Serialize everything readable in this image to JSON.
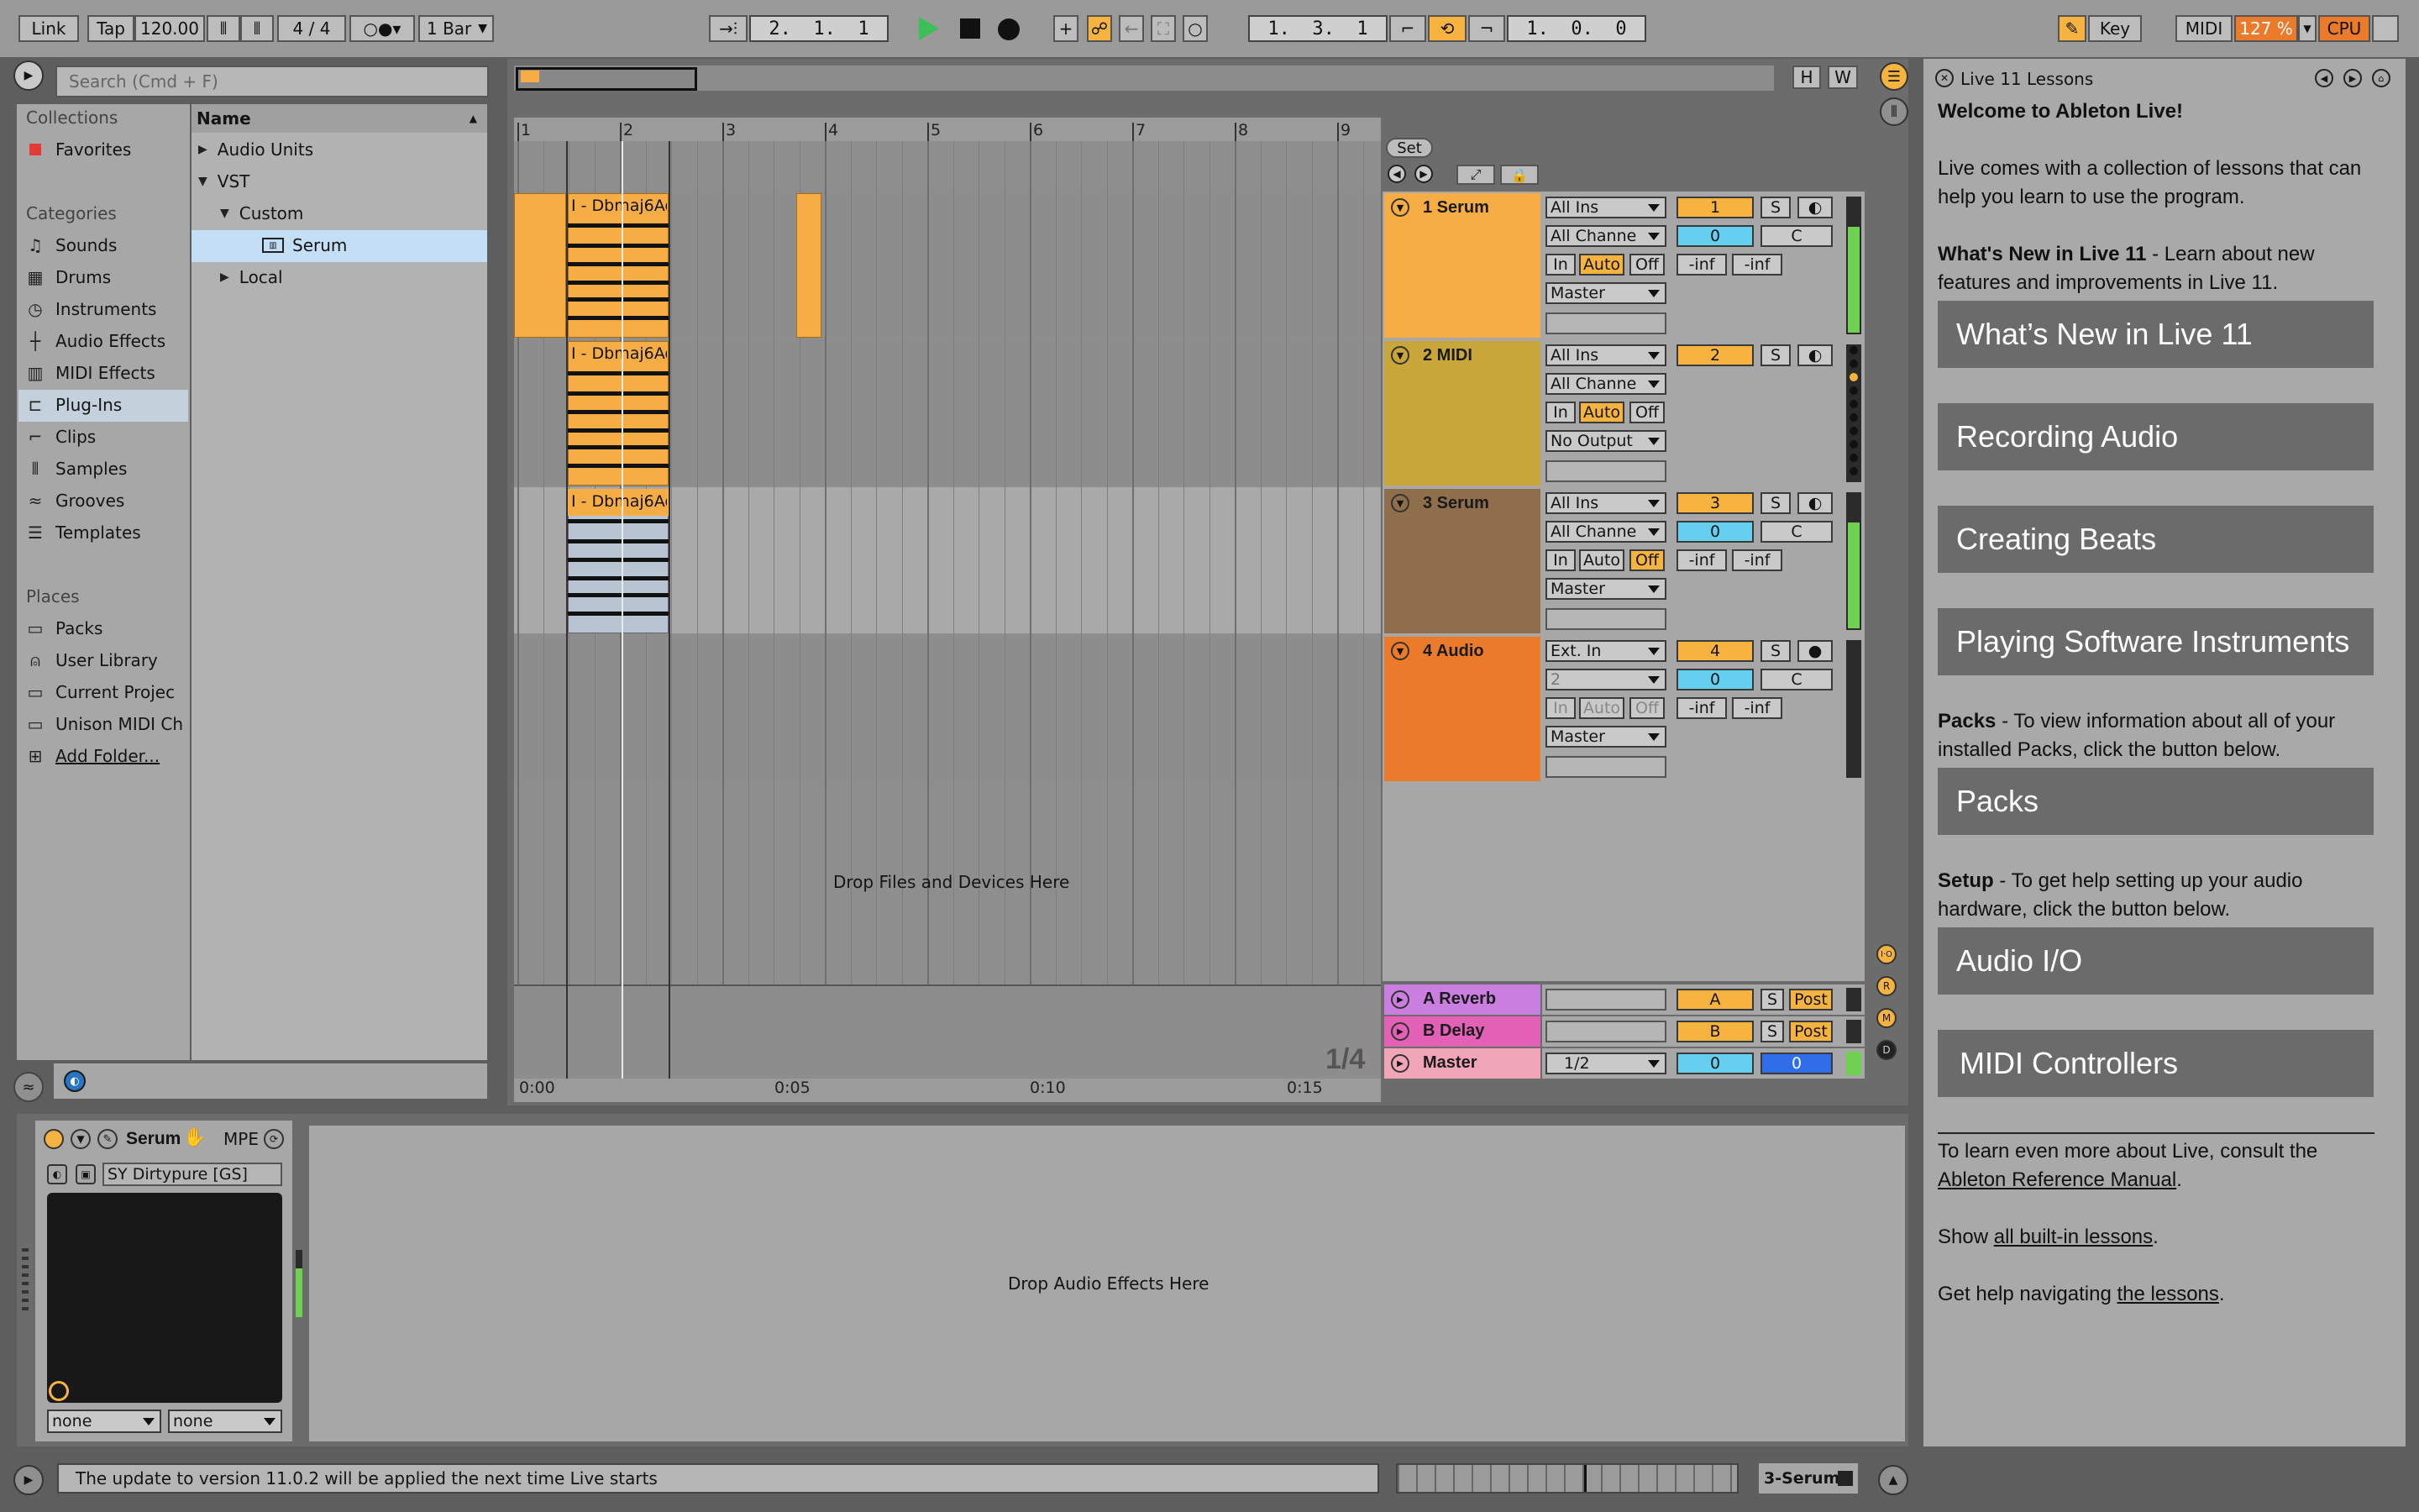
{
  "transport": {
    "link": "Link",
    "tap": "Tap",
    "tempo": "120.00",
    "time_signature": "4 / 4",
    "quantize": "1 Bar",
    "position": "2.  1.  1",
    "loop_start": "1.  3.  1",
    "loop_length": "1.  0.  0",
    "key_label": "Key",
    "midi_label": "MIDI",
    "zoom": "127 %",
    "cpu_label": "CPU"
  },
  "browser": {
    "search_placeholder": "Search (Cmd + F)",
    "collections_title": "Collections",
    "favorites": "Favorites",
    "categories_title": "Categories",
    "categories": [
      "Sounds",
      "Drums",
      "Instruments",
      "Audio Effects",
      "MIDI Effects",
      "Plug-Ins",
      "Clips",
      "Samples",
      "Grooves",
      "Templates"
    ],
    "places_title": "Places",
    "places": [
      "Packs",
      "User Library",
      "Current Projec",
      "Unison MIDI Ch",
      "Add Folder..."
    ],
    "name_header": "Name",
    "tree": {
      "audio_units": "Audio Units",
      "vst": "VST",
      "custom": "Custom",
      "serum": "Serum",
      "local": "Local"
    }
  },
  "arrangement": {
    "bar_numbers": [
      "1",
      "2",
      "3",
      "4",
      "5",
      "6",
      "7",
      "8",
      "9"
    ],
    "clip_name": "I - Dbmaj6Ad",
    "drop_files": "Drop Files and Devices Here",
    "page_indicator": "1/4",
    "time_labels": [
      "0:00",
      "0:05",
      "0:10",
      "0:15"
    ],
    "set_label": "Set",
    "h_label": "H",
    "w_label": "W"
  },
  "tracks": [
    {
      "name": "1 Serum",
      "input": "All Ins",
      "channel": "All Channe",
      "monitor": [
        "In",
        "Auto",
        "Off"
      ],
      "output": "Master",
      "number": "1",
      "volume": "0",
      "pan": "C",
      "peak_l": "-inf",
      "peak_r": "-inf",
      "color": "#f6ad44"
    },
    {
      "name": "2 MIDI",
      "input": "All Ins",
      "channel": "All Channe",
      "monitor": [
        "In",
        "Auto",
        "Off"
      ],
      "output": "No Output",
      "number": "2",
      "color": "#c8a63a"
    },
    {
      "name": "3 Serum",
      "input": "All Ins",
      "channel": "All Channe",
      "monitor": [
        "In",
        "Auto",
        "Off"
      ],
      "output": "Master",
      "number": "3",
      "volume": "0",
      "pan": "C",
      "peak_l": "-inf",
      "peak_r": "-inf",
      "color": "#8e6e4b"
    },
    {
      "name": "4 Audio",
      "input": "Ext. In",
      "channel": "2",
      "monitor": [
        "In",
        "Auto",
        "Off"
      ],
      "output": "Master",
      "number": "4",
      "volume": "0",
      "pan": "C",
      "peak_l": "-inf",
      "peak_r": "-inf",
      "color": "#ec7a2b"
    }
  ],
  "returns": [
    {
      "name": "A Reverb",
      "letter": "A",
      "post": "Post",
      "color": "#c97ee0"
    },
    {
      "name": "B Delay",
      "letter": "B",
      "post": "Post",
      "color": "#e261b7"
    },
    {
      "name": "Master",
      "output": "1/2",
      "volume": "0",
      "pan": "0",
      "color": "#f0a6b8"
    }
  ],
  "mixer_labels": {
    "solo": "S"
  },
  "device": {
    "name": "Serum",
    "mpe": "MPE",
    "preset": "SY Dirtypure [GS]",
    "macro1": "none",
    "macro2": "none",
    "drop_effects": "Drop Audio Effects Here"
  },
  "status": {
    "message": "The update to version 11.0.2 will be applied the next time Live starts",
    "selected_track": "3-Serum"
  },
  "lessons": {
    "title": "Live 11 Lessons",
    "welcome": "Welcome to Ableton Live!",
    "intro": "Live comes with a collection of lessons that can help you learn to use the program.",
    "whats_new_bold": "What's New in Live 11",
    "whats_new_text": " - Learn about new features and improvements in Live 11.",
    "buttons": [
      "What’s New in Live 11",
      "Recording Audio",
      "Creating Beats",
      "Playing Software Instruments"
    ],
    "packs_bold": "Packs",
    "packs_text": " - To view information about all of your installed Packs, click the button below.",
    "packs_button": "Packs",
    "setup_bold": "Setup",
    "setup_text": " - To get help setting up your audio hardware, click the button below.",
    "setup_buttons": [
      "Audio I/O",
      "MIDI Controllers"
    ],
    "learn_more": "To learn even more about Live, consult the",
    "manual_link": "Ableton Reference Manual",
    "show_text": "Show",
    "all_lessons_link": "all built-in lessons",
    "help_text": "Get help navigating",
    "lessons_link": "the lessons"
  }
}
